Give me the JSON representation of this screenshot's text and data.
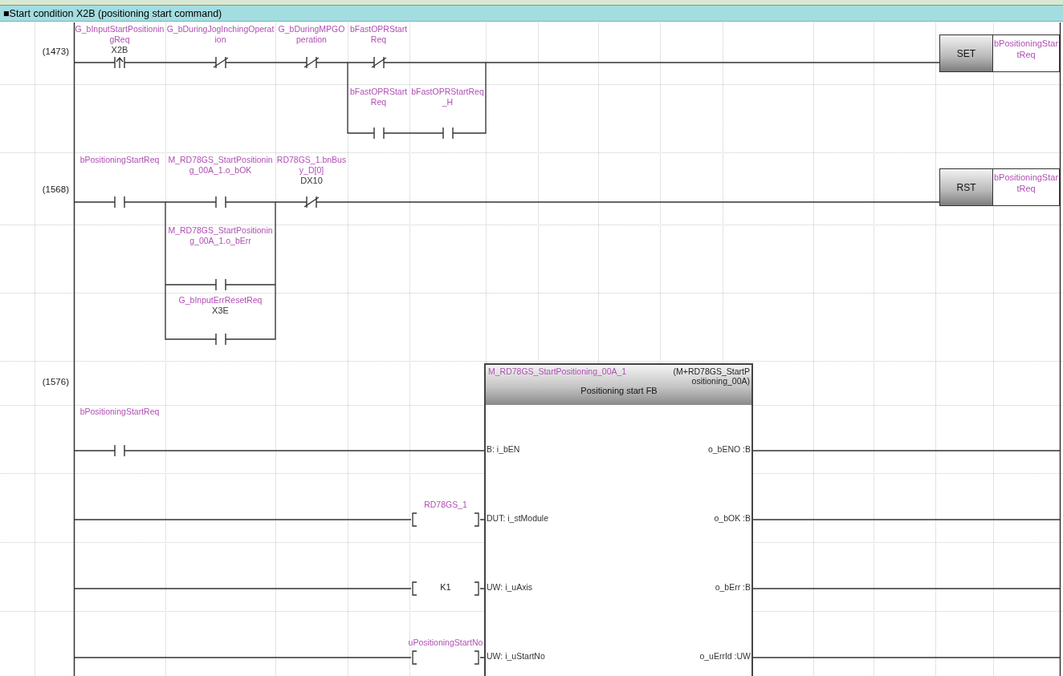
{
  "section_title": "■Start condition X2B (positioning start command)",
  "rungs": [
    {
      "step": "(1473)",
      "contacts": [
        {
          "kind": "rising",
          "label": "G_bInputStartPositioningReq",
          "device": "X2B"
        },
        {
          "kind": "nc",
          "label": "G_bDuringJogInchingOperation"
        },
        {
          "kind": "nc",
          "label": "G_bDuringMPGOperation"
        },
        {
          "kind": "nc",
          "label": "bFastOPRStartReq"
        },
        {
          "kind": "no",
          "label": "bFastOPRStartReq"
        },
        {
          "kind": "no",
          "label": "bFastOPRStartReq_H"
        }
      ],
      "instruction": {
        "name": "SET",
        "operand": "bPositioningStartReq"
      }
    },
    {
      "step": "(1568)",
      "contacts": [
        {
          "kind": "no",
          "label": "bPositioningStartReq"
        },
        {
          "kind": "no",
          "label": "M_RD78GS_StartPositioning_00A_1.o_bOK"
        },
        {
          "kind": "nc",
          "label": "RD78GS_1.bnBusy_D[0]",
          "device": "DX10"
        },
        {
          "kind": "no",
          "label": "M_RD78GS_StartPositioning_00A_1.o_bErr"
        },
        {
          "kind": "no",
          "label": "G_bInputErrResetReq",
          "device": "X3E"
        }
      ],
      "instruction": {
        "name": "RST",
        "operand": "bPositioningStartReq"
      }
    },
    {
      "step": "(1576)",
      "contacts": [
        {
          "kind": "no",
          "label": "bPositioningStartReq"
        }
      ],
      "function_block": {
        "instance": "M_RD78GS_StartPositioning_00A_1",
        "type": "(M+RD78GS_StartPositioning_00A)",
        "comment": "Positioning start FB",
        "inputs": [
          {
            "pin": "B: i_bEN"
          },
          {
            "pin": "DUT: i_stModule",
            "operand": "RD78GS_1",
            "kind": "variable"
          },
          {
            "pin": "UW: i_uAxis",
            "operand": "K1",
            "kind": "constant"
          },
          {
            "pin": "UW: i_uStartNo",
            "operand": "uPositioningStartNo",
            "kind": "variable"
          }
        ],
        "outputs": [
          "o_bENO :B",
          "o_bOK :B",
          "o_bErr :B",
          "o_uErrId :UW"
        ]
      }
    }
  ]
}
